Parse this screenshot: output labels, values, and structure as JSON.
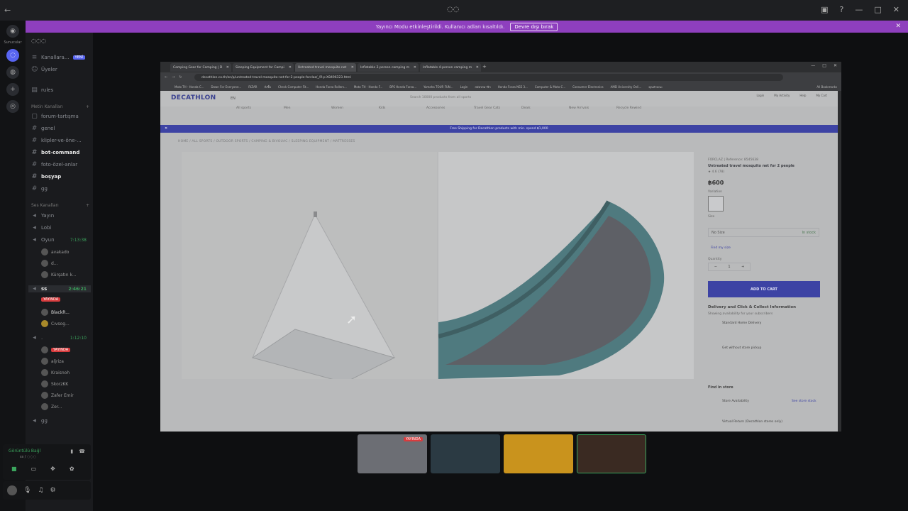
{
  "app": {
    "title_glyph": "◌◌"
  },
  "banner": {
    "text": "Yayıncı Modu etkinleştirildi. Kullanıcı adları kısaltıldı.",
    "button": "Devre dışı bırak"
  },
  "servers": {
    "label": "Sunucular"
  },
  "sidebar": {
    "server_name": "◌◌◌",
    "top": [
      {
        "label": "Kanallara...",
        "badge": "YENİ"
      },
      {
        "label": "Üyeler"
      }
    ],
    "text_category": "Metin Kanalları",
    "voice_category": "Ses Kanalları",
    "text_channels": [
      "rules",
      "forum-tartışma",
      "genel",
      "klipler-ve-öne-...",
      "bot-command",
      "foto-özel-anlar",
      "boşyap",
      "gg"
    ],
    "voice_channels": [
      "Yayın",
      "Lobi",
      "Oyun"
    ],
    "oyun_timer": "7:13:38",
    "oyun_users": [
      "avakado",
      "d...",
      "Kürşatın k..."
    ],
    "ss_channel": "ss",
    "ss_timer": "2:46:21",
    "ss_users": [
      "BlackR...",
      "Cıvsog..."
    ],
    "dot_channel": ".",
    "dot_timer": "1:12:10",
    "dot_users": [
      "aljriza",
      "Kraisnoh",
      "SkorzKK",
      "Zafer Emir",
      "Zer..."
    ],
    "gg_voice": "gg",
    "live_label": "YAYINDA"
  },
  "voice_bar": {
    "status": "Görüntülü Bağl",
    "channel": "ss / ◌◌◌"
  },
  "browser": {
    "tabs": [
      "Camping Gear for Camping | D",
      "Sleeping Equipment for Campi",
      "Untreated travel mosquito net",
      "Inflatable 2-person camping m",
      "Inflatable 4-person camping m"
    ],
    "url": "decathlon.co.th/en/p/untreated-travel-mosquito-net-for-2-people-forclaz/_/R-p-X8496323.html",
    "bookmarks": [
      "Moto TH - Honda C...",
      "Down For Everyone...",
      "RIZAR",
      "สั่งซื้อ",
      "Check Computer Fit...",
      "Honda Forza Rollers...",
      "Moto TH - Honda F...",
      "BPS Honda Forza...",
      "Yamaha TOUR FUN...",
      "Login",
      "สมัครสมาชิก",
      "Honda Forza NSS 3...",
      "Computer & Moto C...",
      "Consumer Electronics",
      "AMD University Onli...",
      "คุณลักษณะ"
    ],
    "all_bookmarks": "All Bookmarks"
  },
  "site": {
    "logo": "DECATHLON",
    "lang": "EN",
    "search_placeholder": "Search 10000 products from all sports",
    "icons": [
      "Login",
      "My Activity",
      "Help",
      "My Cart"
    ],
    "nav": [
      "All sports",
      "Men",
      "Women",
      "Kids",
      "Accessories",
      "Travel Gear Cats",
      "Deals",
      "New Arrivals",
      "Recycle Rewind"
    ],
    "promo": "Free Shipping for Decathlon products with min. spend ฿1,000",
    "breadcrumb": "HOME  /  ALL SPORTS  /  OUTDOOR SPORTS  /  CAMPING & BIVOUAC  /  SLEEPING EQUIPMENT  /  MATTRESSES",
    "product": {
      "brand": "FORCLAZ | Reference: 8545638",
      "name": "Untreated travel mosquito net for 2 people",
      "rating": "★ 4.6 (78)",
      "price": "฿600",
      "variation": "Variation",
      "size_label": "Size",
      "size_value": "No Size",
      "size_status": "In stock",
      "find_size": "Find my size",
      "qty_label": "Quantity",
      "qty": "1",
      "cart": "ADD TO CART",
      "delivery_title": "Delivery and Click & Collect Information",
      "delivery_sub": "Showing availability for your subscribers",
      "standard": "Standard Home Delivery",
      "pickup": "Get without store pickup",
      "find_store": "Find in store",
      "store_avail": "Store Availability",
      "store_link": "See store stock",
      "store_note": "Virtual Return (Decathlon stores only)"
    }
  },
  "streams": [
    {
      "label": "YAYINDA"
    },
    {
      "label": ""
    },
    {
      "label": ""
    },
    {
      "label": ""
    }
  ]
}
